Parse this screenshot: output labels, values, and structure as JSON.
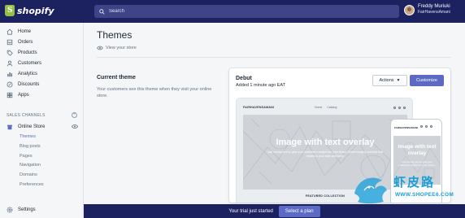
{
  "topbar": {
    "logo_text": "shopify",
    "search_placeholder": "Search",
    "user_name": "Freddy Muriuki",
    "user_shop": "FairHavensAmani"
  },
  "sidebar": {
    "items": [
      {
        "label": "Home",
        "icon": "home-icon"
      },
      {
        "label": "Orders",
        "icon": "orders-icon"
      },
      {
        "label": "Products",
        "icon": "tag-icon"
      },
      {
        "label": "Customers",
        "icon": "customers-icon"
      },
      {
        "label": "Analytics",
        "icon": "analytics-icon"
      },
      {
        "label": "Discounts",
        "icon": "discount-icon"
      },
      {
        "label": "Apps",
        "icon": "apps-icon"
      }
    ],
    "sales_channels_header": "SALES CHANNELS",
    "online_store_label": "Online Store",
    "sub_items": [
      "Themes",
      "Blog posts",
      "Pages",
      "Navigation",
      "Domains",
      "Preferences"
    ],
    "active_sub": "Themes",
    "settings_label": "Settings"
  },
  "main": {
    "title": "Themes",
    "view_store": "View your store",
    "current_theme_title": "Current theme",
    "current_theme_desc": "Your customers see this theme when they visit your online store."
  },
  "theme_card": {
    "name": "Debut",
    "added": "Added 1 minute ago EAT",
    "actions_label": "Actions",
    "customize_label": "Customize",
    "preview_brand": "FAIRHAVENSAMANI",
    "preview_links": [
      "Home",
      "Catalog"
    ],
    "hero_title": "Image with text overlay",
    "hero_subtitle": "Use overlay text to give your customers insight into your brand. Select imagery and text that relates to your style and story.",
    "featured": "FEATURED COLLECTION",
    "mobile_brand": "FAIRHAVENSAMANI",
    "mobile_hero_title": "Image with text overlay",
    "mobile_hero_subtitle": "Use overlay text to give your customers insight into your brand."
  },
  "banner": {
    "trial_text": "Your trial just started",
    "select_plan": "Select a plan"
  },
  "watermark": {
    "text": "虾皮路",
    "url": "WWW.SHOPEE6.COM"
  },
  "colors": {
    "topbar": "#1c2260",
    "accent": "#5c6ac4",
    "watermark": "#1a9fd6"
  }
}
